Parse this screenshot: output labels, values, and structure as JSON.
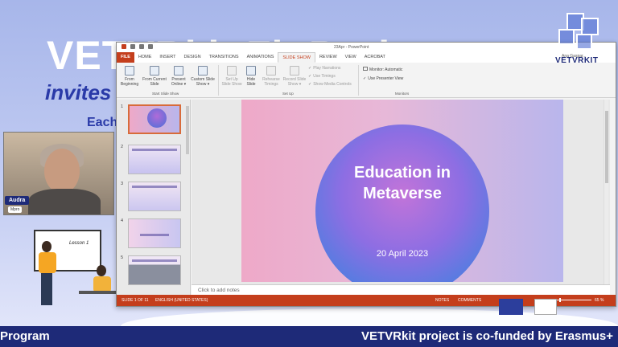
{
  "background": {
    "title": "VETVRkit Fb Project",
    "invites": "invites",
    "each": "Each",
    "footer_left": "Program",
    "footer_right": "VETVRkit project is co-funded by Erasmus+"
  },
  "webcam": {
    "name": "Audra",
    "sub": "Mpro"
  },
  "illustration": {
    "board_text": "Lesson 1"
  },
  "powerpoint": {
    "window_title": "23Apr - PowerPoint",
    "tabs": [
      "FILE",
      "HOME",
      "INSERT",
      "DESIGN",
      "TRANSITIONS",
      "ANIMATIONS",
      "SLIDE SHOW",
      "REVIEW",
      "VIEW",
      "ACROBAT"
    ],
    "active_tab": "SLIDE SHOW",
    "ribbon": {
      "from_beginning": "From Beginning",
      "from_current": "From Current Slide",
      "present_online": "Present Online ▾",
      "custom_show": "Custom Slide Show ▾",
      "group_start": "Start Slide Show",
      "set_up": "Set Up Slide Show",
      "hide_slide": "Hide Slide",
      "rehearse": "Rehearse Timings",
      "record": "Record Slide Show ▾",
      "play_narrations": "Play Narrations",
      "use_timings": "Use Timings",
      "show_media": "Show Media Controls",
      "group_setup": "Set Up",
      "monitor": "Monitor: Automatic",
      "presenter_view": "Use Presenter View",
      "group_monitors": "Monitors"
    },
    "thumbnails": [
      {
        "num": "1",
        "selected": true
      },
      {
        "num": "2",
        "selected": false
      },
      {
        "num": "3",
        "selected": false
      },
      {
        "num": "4",
        "selected": false
      },
      {
        "num": "5",
        "selected": false
      }
    ],
    "slide": {
      "title_line1": "Education in",
      "title_line2": "Metaverse",
      "date": "20 April  2023"
    },
    "notes_placeholder": "Click to add notes",
    "status": {
      "slide_count": "SLIDE 1 OF 11",
      "language": "ENGLISH (UNITED STATES)",
      "notes": "NOTES",
      "comments": "COMMENTS",
      "zoom": "65 %"
    }
  },
  "logo": {
    "text": "VETVRKIT",
    "caption": "Ana Gaspar..."
  },
  "colors": {
    "accent": "#c43e1c",
    "brand": "#1e2a78"
  }
}
